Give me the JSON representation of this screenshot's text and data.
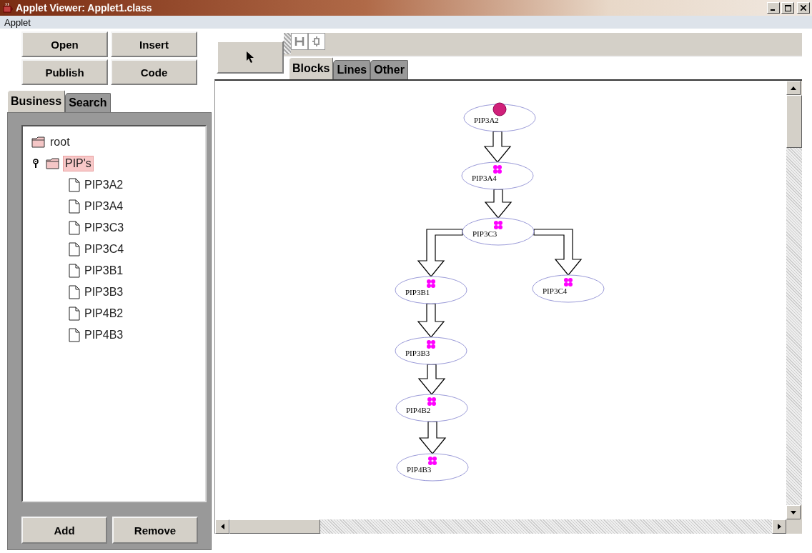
{
  "window": {
    "title": "Applet Viewer: Applet1.class"
  },
  "menu": [
    "Applet"
  ],
  "actions": [
    "Open",
    "Insert",
    "Publish",
    "Code"
  ],
  "left_tabs": [
    {
      "label": "Business",
      "selected": true
    },
    {
      "label": "Search",
      "selected": false
    }
  ],
  "tree": [
    {
      "label": "root",
      "kind": "folder",
      "selected": false
    },
    {
      "label": "PIP's",
      "kind": "folder",
      "selected": true,
      "expanded": true,
      "children": [
        {
          "label": "PIP3A2",
          "kind": "file",
          "selected": false
        },
        {
          "label": "PIP3A4",
          "kind": "file",
          "selected": false
        },
        {
          "label": "PIP3C3",
          "kind": "file",
          "selected": false
        },
        {
          "label": "PIP3C4",
          "kind": "file",
          "selected": false
        },
        {
          "label": "PIP3B1",
          "kind": "file",
          "selected": false
        },
        {
          "label": "PIP3B3",
          "kind": "file",
          "selected": false
        },
        {
          "label": "PIP4B2",
          "kind": "file",
          "selected": false
        },
        {
          "label": "PIP4B3",
          "kind": "file",
          "selected": false
        }
      ]
    }
  ],
  "tree_buttons": [
    "Add",
    "Remove"
  ],
  "palette_tabs": [
    {
      "label": "Blocks",
      "selected": true
    },
    {
      "label": "Lines",
      "selected": false
    },
    {
      "label": "Other",
      "selected": false
    }
  ],
  "diagram": {
    "nodes": [
      {
        "label": "PIP3A2",
        "kind": "start"
      },
      {
        "label": "PIP3A4",
        "kind": "step"
      },
      {
        "label": "PIP3C3",
        "kind": "step"
      },
      {
        "label": "PIP3B1",
        "kind": "step"
      },
      {
        "label": "PIP3C4",
        "kind": "step"
      },
      {
        "label": "PIP3B3",
        "kind": "step"
      },
      {
        "label": "PIP4B2",
        "kind": "step"
      },
      {
        "label": "PIP4B3",
        "kind": "step"
      }
    ]
  }
}
